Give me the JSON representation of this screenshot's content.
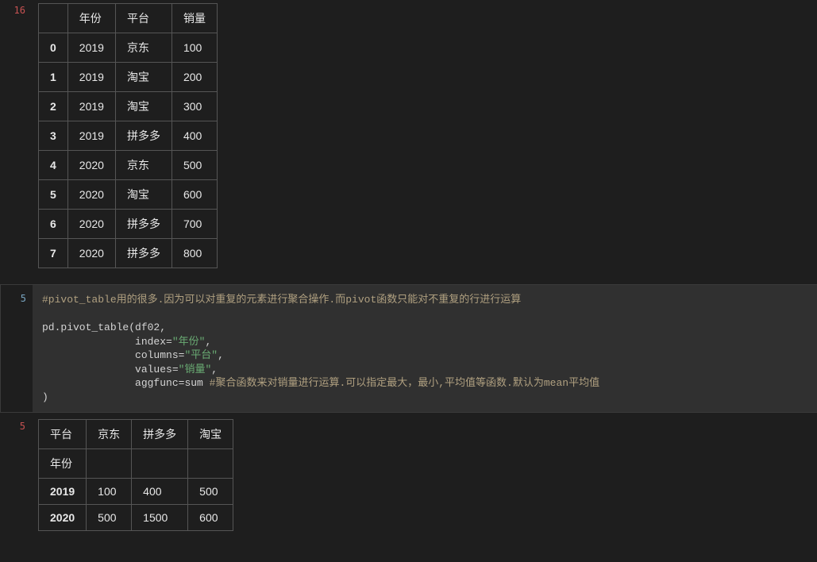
{
  "cell1": {
    "exec_count": "16",
    "table": {
      "headers": [
        "",
        "年份",
        "平台",
        "销量"
      ],
      "rows": [
        {
          "idx": "0",
          "year": "2019",
          "platform": "京东",
          "sales": "100"
        },
        {
          "idx": "1",
          "year": "2019",
          "platform": "淘宝",
          "sales": "200"
        },
        {
          "idx": "2",
          "year": "2019",
          "platform": "淘宝",
          "sales": "300"
        },
        {
          "idx": "3",
          "year": "2019",
          "platform": "拼多多",
          "sales": "400"
        },
        {
          "idx": "4",
          "year": "2020",
          "platform": "京东",
          "sales": "500"
        },
        {
          "idx": "5",
          "year": "2020",
          "platform": "淘宝",
          "sales": "600"
        },
        {
          "idx": "6",
          "year": "2020",
          "platform": "拼多多",
          "sales": "700"
        },
        {
          "idx": "7",
          "year": "2020",
          "platform": "拼多多",
          "sales": "800"
        }
      ]
    }
  },
  "cell2": {
    "exec_count": "5",
    "code": {
      "comment1_a": "#pivot_table",
      "comment1_b": "用的很多.因为可以对重复的元素进行聚合操作.而",
      "comment1_c": "pivot",
      "comment1_d": "函数只能对不重复的行进行运算",
      "line_pd": "pd.pivot_table(df02,",
      "indent": "               ",
      "kw_index": "index=",
      "str_index": "\"年份\"",
      "kw_columns": "columns=",
      "str_columns": "\"平台\"",
      "kw_values": "values=",
      "str_values": "\"销量\"",
      "kw_aggfunc": "aggfunc=sum ",
      "comment_agg": "#聚合函数来对销量进行运算.可以指定最大，最小,平均值等函数.默认为mean平均值",
      "close": ")"
    }
  },
  "cell3": {
    "exec_count": "5",
    "table": {
      "col_label": "平台",
      "row_label": "年份",
      "columns": [
        "京东",
        "拼多多",
        "淘宝"
      ],
      "rows": [
        {
          "year": "2019",
          "v0": "100",
          "v1": "400",
          "v2": "500"
        },
        {
          "year": "2020",
          "v0": "500",
          "v1": "1500",
          "v2": "600"
        }
      ]
    }
  }
}
